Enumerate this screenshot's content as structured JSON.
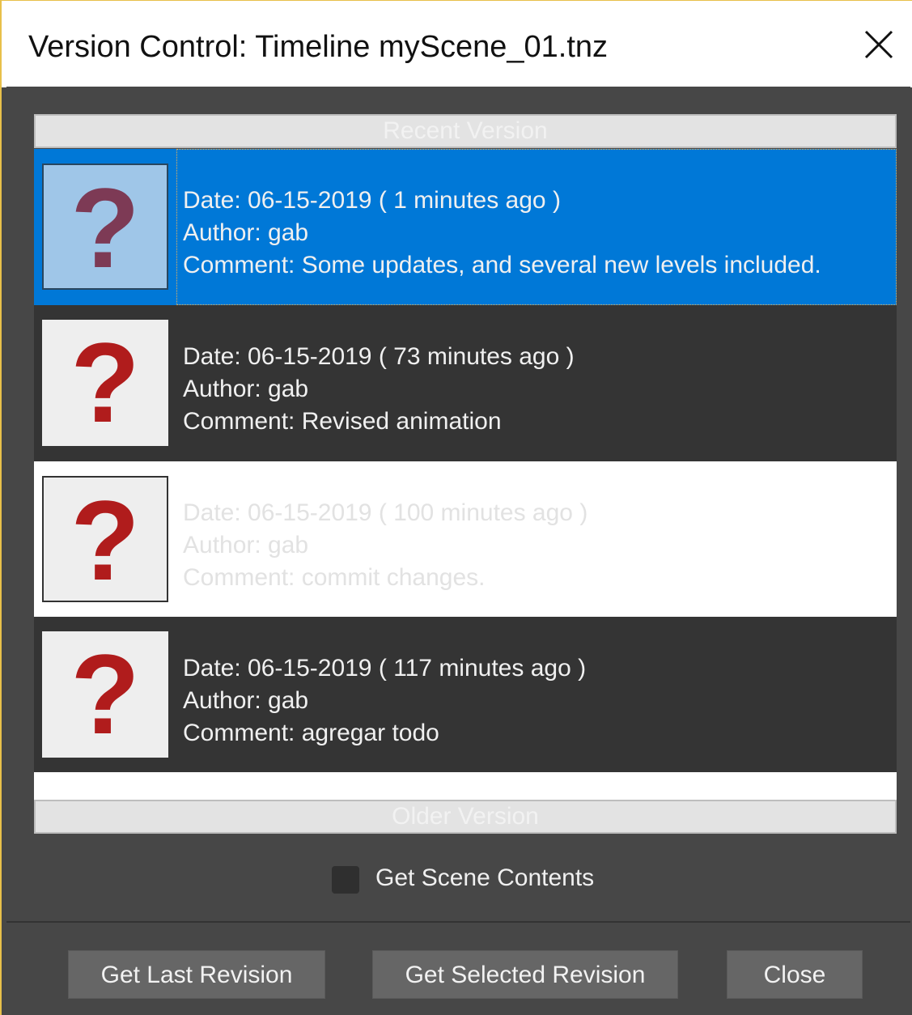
{
  "window": {
    "title": "Version Control: Timeline myScene_01.tnz"
  },
  "list": {
    "recent_header": "Recent Version",
    "older_header": "Older Version",
    "revisions": [
      {
        "date": "Date: 06-15-2019 ( 1 minutes ago )",
        "author": "Author: gab",
        "comment": "Comment: Some updates, and several new levels included.",
        "thumbnail": "?",
        "state": "selected"
      },
      {
        "date": "Date: 06-15-2019 ( 73 minutes ago )",
        "author": "Author: gab",
        "comment": "Comment: Revised animation",
        "thumbnail": "?",
        "state": "normal"
      },
      {
        "date": "Date: 06-15-2019 ( 100 minutes ago )",
        "author": "Author: gab",
        "comment": "Comment:  commit changes.",
        "thumbnail": "?",
        "state": "light"
      },
      {
        "date": "Date: 06-15-2019 ( 117 minutes ago )",
        "author": "Author: gab",
        "comment": "Comment: agregar todo",
        "thumbnail": "?",
        "state": "normal"
      }
    ]
  },
  "options": {
    "get_scene_contents_label": "Get Scene Contents",
    "get_scene_contents_checked": false
  },
  "buttons": {
    "get_last": "Get Last Revision",
    "get_selected": "Get Selected Revision",
    "close": "Close"
  },
  "icons": {
    "close": "close-icon",
    "thumbnail": "question-mark-icon"
  },
  "colors": {
    "selection": "#0078d7",
    "row_dark": "#343434",
    "panel": "#474747",
    "question_mark": "#b01c1c",
    "window_border": "#e8c04a"
  }
}
